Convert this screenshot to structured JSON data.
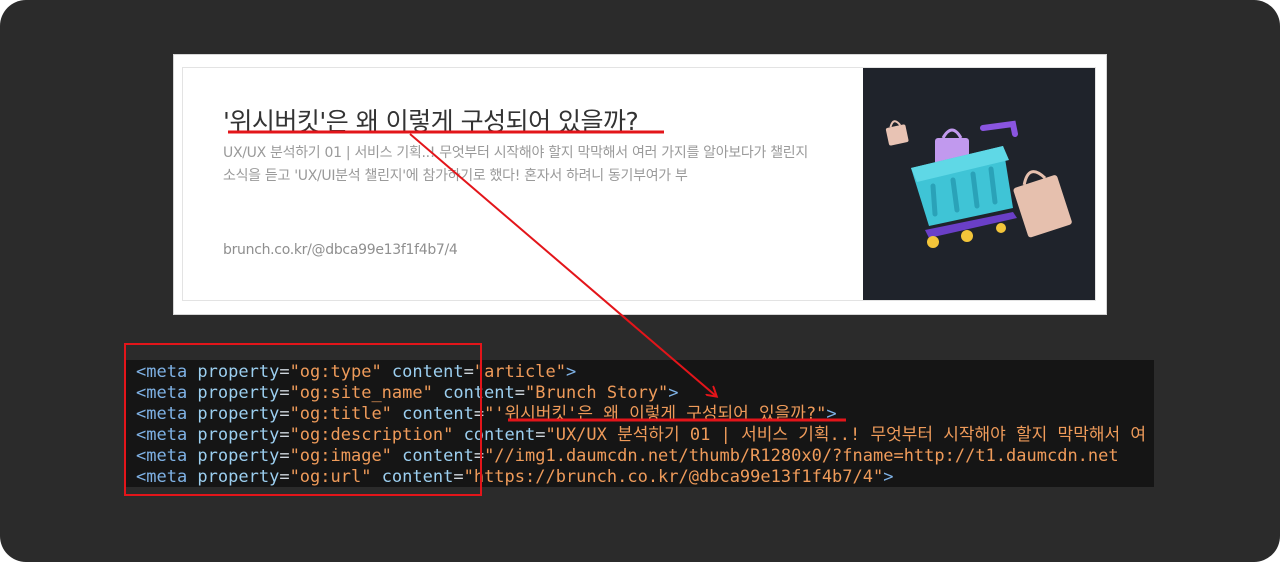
{
  "preview_card": {
    "title": "'위시버킷'은 왜 이렇게 구성되어 있을까?",
    "description": "UX/UX 분석하기 01 | 서비스 기획..! 무엇부터 시작해야 할지 막막해서 여러 가지를 알아보다가 챌린지 소식을 듣고 'UX/UI분석 챌린지'에 참가하기로 했다! 혼자서 하려니 동기부여가 부",
    "url": "brunch.co.kr/@dbca99e13f1f4b7/4",
    "image_icon": "shopping-cart-icon"
  },
  "code": {
    "lines": [
      {
        "tag_open": "<meta ",
        "prop_attr": "property",
        "eq1": "=",
        "prop_value": "\"og:type\"",
        "content_attr": " content",
        "eq2": "=",
        "content_value": "\"article\"",
        "tag_close": ">"
      },
      {
        "tag_open": "<meta ",
        "prop_attr": "property",
        "eq1": "=",
        "prop_value": "\"og:site_name\"",
        "content_attr": " content",
        "eq2": "=",
        "content_value": "\"Brunch Story\"",
        "tag_close": ">"
      },
      {
        "tag_open": "<meta ",
        "prop_attr": "property",
        "eq1": "=",
        "prop_value": "\"og:title\"",
        "content_attr": " content",
        "eq2": "=",
        "content_value": "\"'위시버킷'은 왜 이렇게 구성되어 있을까?\"",
        "tag_close": ">"
      },
      {
        "tag_open": "<meta ",
        "prop_attr": "property",
        "eq1": "=",
        "prop_value": "\"og:description\"",
        "content_attr": " content",
        "eq2": "=",
        "content_value": "\"UX/UX 분석하기 01 | 서비스 기획..! 무엇부터 시작해야 할지 막막해서 여",
        "tag_close": ""
      },
      {
        "tag_open": "<meta ",
        "prop_attr": "property",
        "eq1": "=",
        "prop_value": "\"og:image\"",
        "content_attr": " content",
        "eq2": "=",
        "content_value": "\"//img1.daumcdn.net/thumb/R1280x0/?fname=http://t1.daumcdn.net",
        "tag_close": ""
      },
      {
        "tag_open": "<meta ",
        "prop_attr": "property",
        "eq1": "=",
        "prop_value": "\"og:url\"",
        "content_attr": " content",
        "eq2": "=",
        "content_value": "\"https://brunch.co.kr/@dbca99e13f1f4b7/4\"",
        "tag_close": ">"
      }
    ]
  },
  "colors": {
    "annotation_red": "#e3151a",
    "background": "#2b2b2b",
    "code_bg": "#151515"
  }
}
